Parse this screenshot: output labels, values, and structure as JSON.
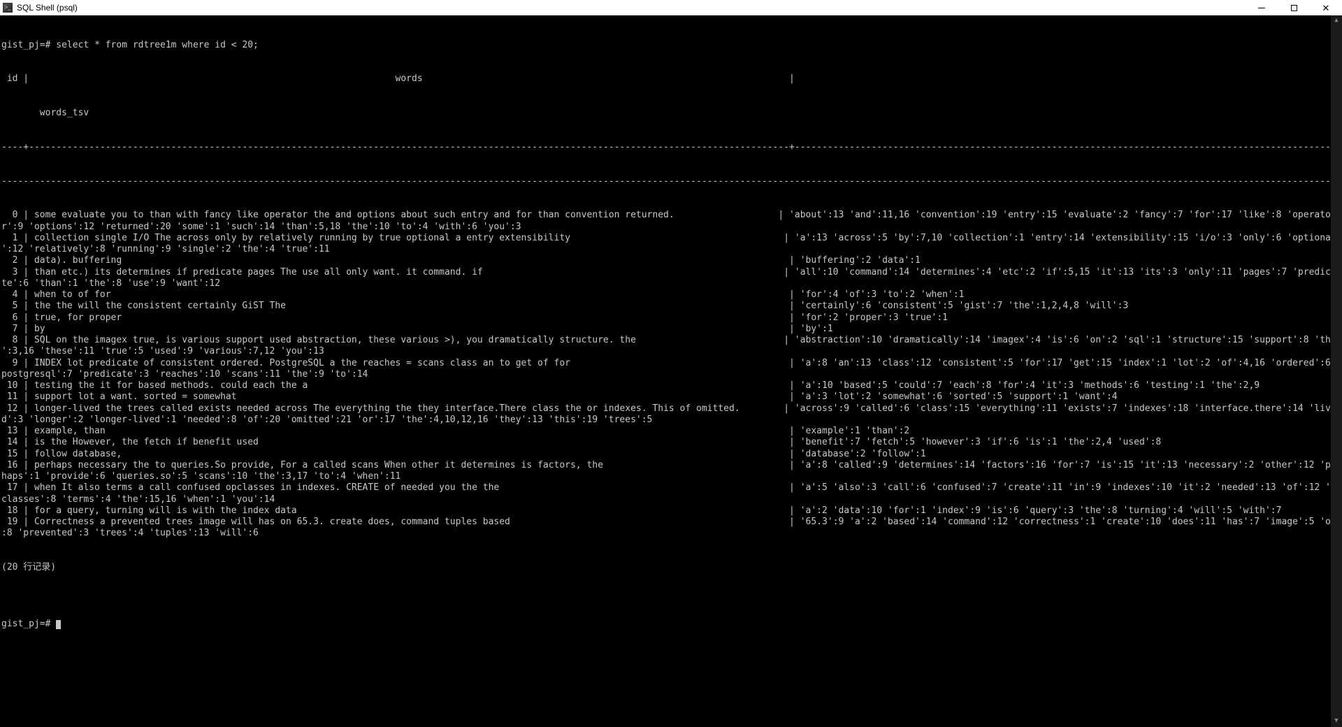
{
  "window": {
    "title": "SQL Shell (psql)"
  },
  "prompt": "gist_pj=#",
  "query": "select * from rdtree1m where id < 20;",
  "header_line": " id |                                                                   words                                                                   |",
  "header_line2": "       words_tsv",
  "separator": "----+-------------------------------------------------------------------------------------------------------------------------------------------+-----------------------------------------------------------------------------------------------------------",
  "separator2": "----------------------------------------------------------------------------------------------------------------------------------------------------------------------------------------------------------------------------------------------------------",
  "rows": [
    "  0 | some evaluate you to than with fancy like operator the and options about such entry and for than convention returned.                   | 'about':13 'and':11,16 'convention':19 'entry':15 'evaluate':2 'fancy':7 'for':17 'like':8 'operato",
    "r':9 'options':12 'returned':20 'some':1 'such':14 'than':5,18 'the':10 'to':4 'with':6 'you':3",
    "  1 | collection single I/O The across only by relatively running by true optional a entry extensibility                                       | 'a':13 'across':5 'by':7,10 'collection':1 'entry':14 'extensibility':15 'i/o':3 'only':6 'optional",
    "':12 'relatively':8 'running':9 'single':2 'the':4 'true':11",
    "  2 | data). buffering                                                                                                                          | 'buffering':2 'data':1",
    "  3 | than etc.) its determines if predicate pages The use all only want. it command. if                                                       | 'all':10 'command':14 'determines':4 'etc':2 'if':5,15 'it':13 'its':3 'only':11 'pages':7 'predica",
    "te':6 'than':1 'the':8 'use':9 'want':12",
    "  4 | when to of for                                                                                                                            | 'for':4 'of':3 'to':2 'when':1",
    "  5 | the the will the consistent certainly GiST The                                                                                            | 'certainly':6 'consistent':5 'gist':7 'the':1,2,4,8 'will':3",
    "  6 | true, for proper                                                                                                                          | 'for':2 'proper':3 'true':1",
    "  7 | by                                                                                                                                        | 'by':1",
    "  8 | SQL on the imagex true, is various support used abstraction, these various >), you dramatically structure. the                           | 'abstraction':10 'dramatically':14 'imagex':4 'is':6 'on':2 'sql':1 'structure':15 'support':8 'the",
    "':3,16 'these':11 'true':5 'used':9 'various':7,12 'you':13",
    "  9 | INDEX lot predicate of consistent ordered. PostgreSQL a the reaches = scans class an to get of for                                        | 'a':8 'an':13 'class':12 'consistent':5 'for':17 'get':15 'index':1 'lot':2 'of':4,16 'ordered':6 '",
    "postgresql':7 'predicate':3 'reaches':10 'scans':11 'the':9 'to':14",
    " 10 | testing the it for based methods. could each the a                                                                                        | 'a':10 'based':5 'could':7 'each':8 'for':4 'it':3 'methods':6 'testing':1 'the':2,9",
    " 11 | support lot a want. sorted = somewhat                                                                                                     | 'a':3 'lot':2 'somewhat':6 'sorted':5 'support':1 'want':4",
    " 12 | longer-lived the trees called exists needed across The everything the they interface.There class the or indexes. This of omitted.        | 'across':9 'called':6 'class':15 'everything':11 'exists':7 'indexes':18 'interface.there':14 'live",
    "d':3 'longer':2 'longer-lived':1 'needed':8 'of':20 'omitted':21 'or':17 'the':4,10,12,16 'they':13 'this':19 'trees':5",
    " 13 | example, than                                                                                                                             | 'example':1 'than':2",
    " 14 | is the However, the fetch if benefit used                                                                                                 | 'benefit':7 'fetch':5 'however':3 'if':6 'is':1 'the':2,4 'used':8",
    " 15 | follow database,                                                                                                                          | 'database':2 'follow':1",
    " 16 | perhaps necessary the to queries.So provide, For a called scans When other it determines is factors, the                                  | 'a':8 'called':9 'determines':14 'factors':16 'for':7 'is':15 'it':13 'necessary':2 'other':12 'per",
    "haps':1 'provide':6 'queries.so':5 'scans':10 'the':3,17 'to':4 'when':11",
    " 17 | when It also terms a call confused opclasses in indexes. CREATE of needed you the the                                                     | 'a':5 'also':3 'call':6 'confused':7 'create':11 'in':9 'indexes':10 'it':2 'needed':13 'of':12 'op",
    "classes':8 'terms':4 'the':15,16 'when':1 'you':14",
    " 18 | for a query, turning will is with the index data                                                                                          | 'a':2 'data':10 'for':1 'index':9 'is':6 'query':3 'the':8 'turning':4 'will':5 'with':7",
    " 19 | Correctness a prevented trees image will has on 65.3. create does, command tuples based                                                   | '65.3':9 'a':2 'based':14 'command':12 'correctness':1 'create':10 'does':11 'has':7 'image':5 'on'",
    ":8 'prevented':3 'trees':4 'tuples':13 'will':6"
  ],
  "footer": "(20 行记录)",
  "blank": ""
}
